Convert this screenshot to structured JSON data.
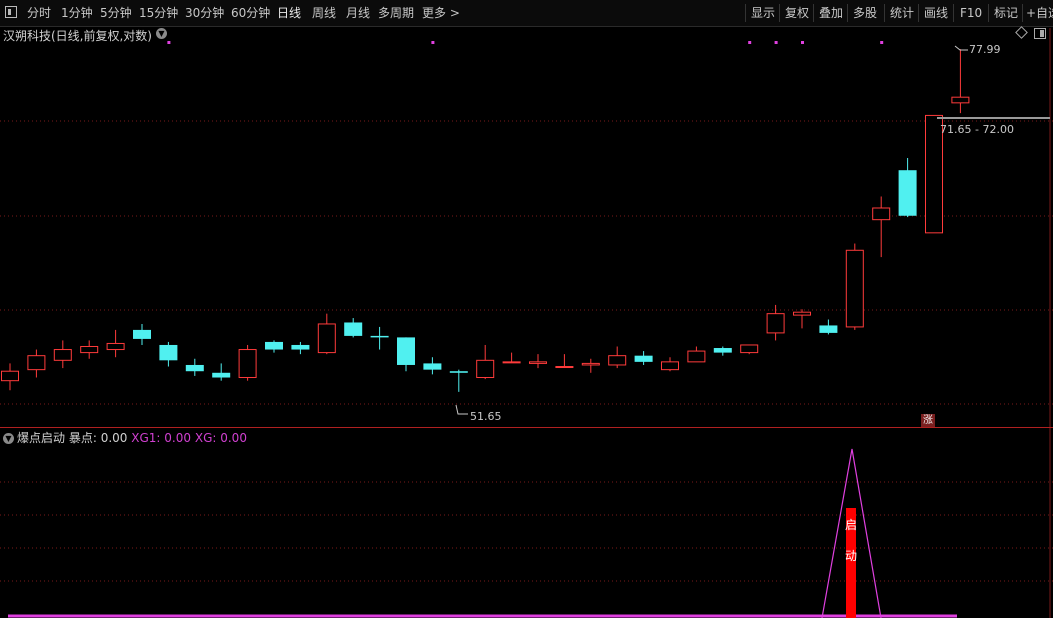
{
  "toolbar": {
    "periods": [
      "分时",
      "1分钟",
      "5分钟",
      "15分钟",
      "30分钟",
      "60分钟",
      "日线",
      "周线",
      "月线",
      "多周期",
      "更多 >"
    ],
    "active": "日线",
    "tools": [
      "显示",
      "复权",
      "叠加",
      "多股",
      "统计",
      "画线",
      "F10",
      "标记",
      "+自选"
    ]
  },
  "stock_title": "汉朔科技(日线,前复权,对数)",
  "indicator": {
    "name": "爆点启动",
    "baodian_label": "暴点:",
    "baodian_value": "0.00",
    "xg1_label": "XG1:",
    "xg1_value": "0.00",
    "xg_label": "XG:",
    "xg_value": "0.00",
    "signal_text": [
      "启",
      "动"
    ]
  },
  "badges": {
    "zhang": "涨"
  },
  "annotations": {
    "high": "77.99",
    "low": "51.65",
    "range": "71.65 - 72.00"
  },
  "colors": {
    "up": "#ff3b3b",
    "down": "#50f0f0",
    "dot": "#e040e0",
    "grid": "#7a1a1a",
    "signal": "#ff0000",
    "line": "#e040e0"
  },
  "chart_data": {
    "type": "candlestick",
    "scale": "log",
    "y_range": [
      50,
      80
    ],
    "candles": [
      {
        "o": 52.3,
        "h": 53.4,
        "l": 51.7,
        "c": 52.9
      },
      {
        "o": 53.0,
        "h": 54.3,
        "l": 52.5,
        "c": 53.9
      },
      {
        "o": 53.6,
        "h": 54.9,
        "l": 53.1,
        "c": 54.3
      },
      {
        "o": 54.1,
        "h": 54.9,
        "l": 53.7,
        "c": 54.5
      },
      {
        "o": 54.3,
        "h": 55.6,
        "l": 53.8,
        "c": 54.7
      },
      {
        "o": 55.6,
        "h": 56.0,
        "l": 54.6,
        "c": 55.0
      },
      {
        "o": 54.6,
        "h": 54.8,
        "l": 53.2,
        "c": 53.6
      },
      {
        "o": 53.3,
        "h": 53.7,
        "l": 52.6,
        "c": 52.9
      },
      {
        "o": 52.8,
        "h": 53.4,
        "l": 52.3,
        "c": 52.5
      },
      {
        "o": 52.5,
        "h": 54.6,
        "l": 52.3,
        "c": 54.3
      },
      {
        "o": 54.8,
        "h": 54.9,
        "l": 54.1,
        "c": 54.3
      },
      {
        "o": 54.6,
        "h": 54.8,
        "l": 54.0,
        "c": 54.3
      },
      {
        "o": 54.1,
        "h": 56.7,
        "l": 54.0,
        "c": 56.0
      },
      {
        "o": 56.1,
        "h": 56.4,
        "l": 55.1,
        "c": 55.2
      },
      {
        "o": 55.2,
        "h": 55.8,
        "l": 54.3,
        "c": 55.1
      },
      {
        "o": 55.1,
        "h": 55.1,
        "l": 52.9,
        "c": 53.3
      },
      {
        "o": 53.4,
        "h": 53.8,
        "l": 52.7,
        "c": 53.0
      },
      {
        "o": 52.9,
        "h": 53.0,
        "l": 51.6,
        "c": 52.8
      },
      {
        "o": 52.5,
        "h": 54.6,
        "l": 52.4,
        "c": 53.6
      },
      {
        "o": 53.5,
        "h": 54.1,
        "l": 53.5,
        "c": 53.5
      },
      {
        "o": 53.4,
        "h": 54.0,
        "l": 53.1,
        "c": 53.5
      },
      {
        "o": 53.2,
        "h": 54.0,
        "l": 53.2,
        "c": 53.2
      },
      {
        "o": 53.3,
        "h": 53.7,
        "l": 52.8,
        "c": 53.4
      },
      {
        "o": 53.3,
        "h": 54.5,
        "l": 53.1,
        "c": 53.9
      },
      {
        "o": 53.9,
        "h": 54.2,
        "l": 53.3,
        "c": 53.5
      },
      {
        "o": 53.0,
        "h": 53.8,
        "l": 52.9,
        "c": 53.5
      },
      {
        "o": 53.5,
        "h": 54.5,
        "l": 53.5,
        "c": 54.2
      },
      {
        "o": 54.4,
        "h": 54.5,
        "l": 53.9,
        "c": 54.1
      },
      {
        "o": 54.1,
        "h": 54.6,
        "l": 54.0,
        "c": 54.6
      },
      {
        "o": 55.4,
        "h": 57.3,
        "l": 54.9,
        "c": 56.7
      },
      {
        "o": 56.6,
        "h": 57.0,
        "l": 55.7,
        "c": 56.8
      },
      {
        "o": 55.9,
        "h": 56.3,
        "l": 55.3,
        "c": 55.4
      },
      {
        "o": 55.8,
        "h": 61.7,
        "l": 55.6,
        "c": 61.2
      },
      {
        "o": 63.5,
        "h": 65.3,
        "l": 60.7,
        "c": 64.4
      },
      {
        "o": 67.4,
        "h": 68.4,
        "l": 63.7,
        "c": 63.8
      },
      {
        "o": 62.5,
        "h": 72.0,
        "l": 62.5,
        "c": 72.0
      },
      {
        "o": 73.1,
        "h": 77.99,
        "l": 72.2,
        "c": 73.6
      }
    ],
    "indicator_series": {
      "signal_index": 32
    }
  }
}
